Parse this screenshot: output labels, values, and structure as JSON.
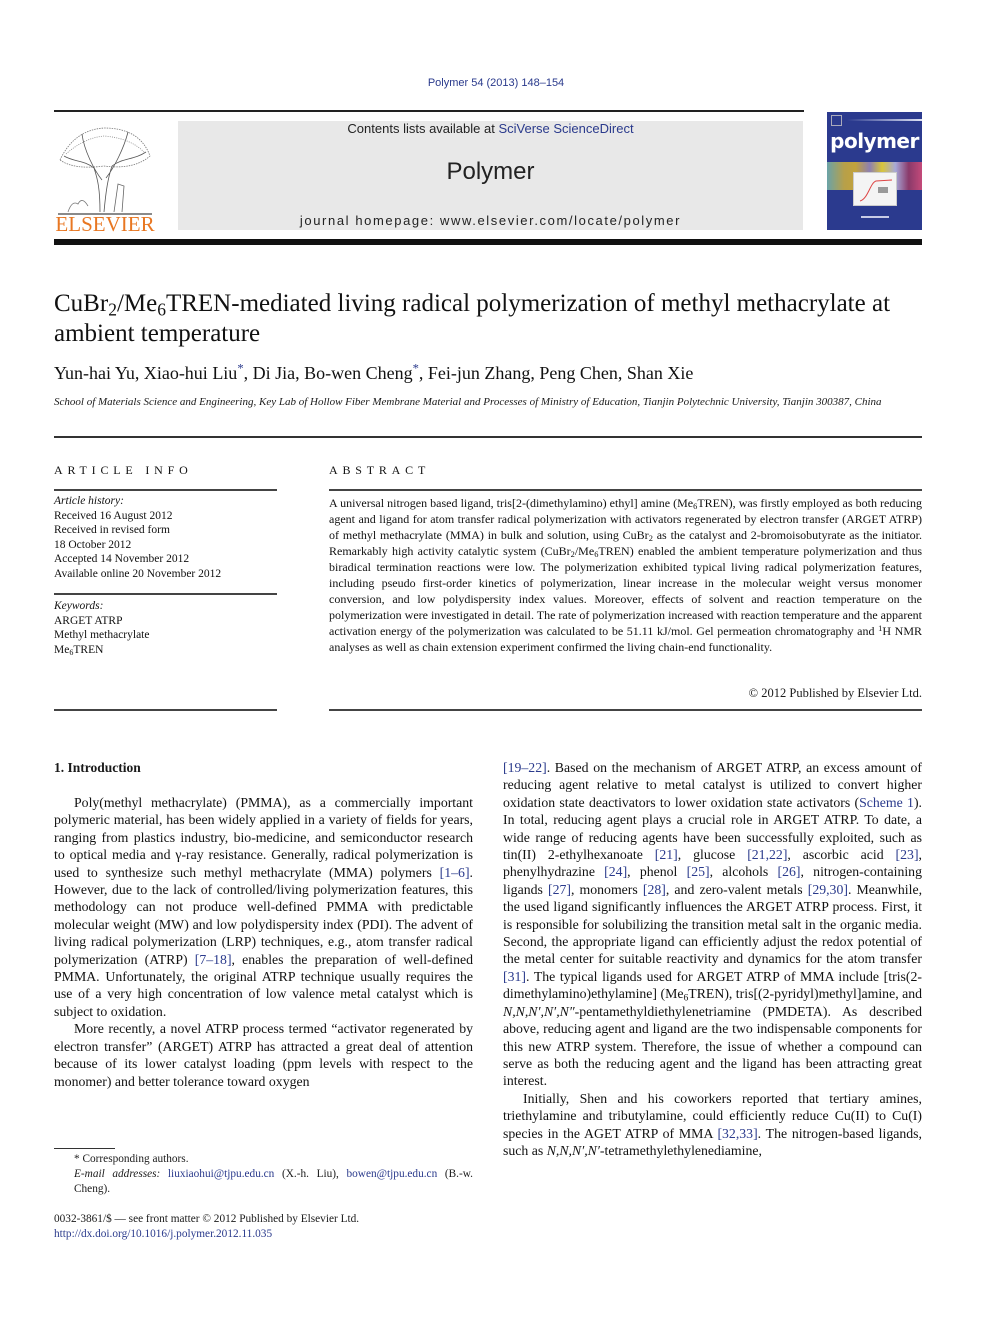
{
  "header": {
    "citation": "Polymer 54 (2013) 148–154",
    "contents_prefix": "Contents lists available at ",
    "contents_link": "SciVerse ScienceDirect",
    "journal_name": "Polymer",
    "homepage": "journal homepage: www.elsevier.com/locate/polymer",
    "publisher_logo_text": "ELSEVIER",
    "cover_title": "polymer",
    "colors": {
      "elsevier_orange": "#e87722",
      "link_blue": "#2a3a8c",
      "cover_blue": "#2b3a8e",
      "banner_gray": "#e8e8e8"
    }
  },
  "article": {
    "title_parts": [
      "CuBr",
      "2",
      "/Me",
      "6",
      "TREN-mediated living radical polymerization of methyl methacrylate at ambient temperature"
    ],
    "authors": [
      {
        "name": "Yun-hai Yu",
        "corresponding": false
      },
      {
        "name": "Xiao-hui Liu",
        "corresponding": true
      },
      {
        "name": "Di Jia",
        "corresponding": false
      },
      {
        "name": "Bo-wen Cheng",
        "corresponding": true
      },
      {
        "name": "Fei-jun Zhang",
        "corresponding": false
      },
      {
        "name": "Peng Chen",
        "corresponding": false
      },
      {
        "name": "Shan Xie",
        "corresponding": false
      }
    ],
    "affiliation": "School of Materials Science and Engineering, Key Lab of Hollow Fiber Membrane Material and Processes of Ministry of Education, Tianjin Polytechnic University, Tianjin 300387, China"
  },
  "article_info": {
    "heading": "ARTICLE INFO",
    "history_label": "Article history:",
    "history": [
      "Received 16 August 2012",
      "Received in revised form",
      "18 October 2012",
      "Accepted 14 November 2012",
      "Available online 20 November 2012"
    ],
    "keywords_label": "Keywords:",
    "keywords": [
      "ARGET ATRP",
      "Methyl methacrylate",
      "Me6TREN"
    ]
  },
  "abstract": {
    "heading": "ABSTRACT",
    "segments": [
      "A universal nitrogen based ligand, tris[2-(dimethylamino) ethyl] amine (Me",
      "6",
      "TREN), was firstly employed as both reducing agent and ligand for atom transfer radical polymerization with activators regenerated by electron transfer (ARGET ATRP) of methyl methacrylate (MMA) in bulk and solution, using CuBr",
      "2",
      " as the catalyst and 2-bromoisobutyrate as the initiator. Remarkably high activity catalytic system (CuBr",
      "2",
      "/Me",
      "6",
      "TREN) enabled the ambient temperature polymerization and thus biradical termination reactions were low. The polymerization exhibited typical living radical polymerization features, including pseudo first-order kinetics of polymerization, linear increase in the molecular weight versus monomer conversion, and low polydispersity index values. Moreover, effects of solvent and reaction temperature on the polymerization were investigated in detail. The rate of polymerization increased with reaction temperature and the apparent activation energy of the polymerization was calculated to be 51.11 kJ/mol. Gel permeation chromatography and ",
      "1",
      "H NMR analyses as well as chain extension experiment confirmed the living chain-end functionality."
    ],
    "copyright": "© 2012 Published by Elsevier Ltd."
  },
  "introduction": {
    "heading": "1.  Introduction",
    "p1": [
      "Poly(methyl methacrylate) (PMMA), as a commercially important polymeric material, has been widely applied in a variety of fields for years, ranging from plastics industry, bio-medicine, and semiconductor research to optical media and γ-ray resistance. Generally, radical polymerization is used to synthesize such methyl methacrylate (MMA) polymers ",
      "[1–6]",
      ". However, due to the lack of controlled/living polymerization features, this methodology can not produce well-defined PMMA with predictable molecular weight (MW) and low polydispersity index (PDI). The advent of living radical polymerization (LRP) techniques, e.g., atom transfer radical polymerization (ATRP) ",
      "[7–18]",
      ", enables the preparation of well-defined PMMA. Unfortunately, the original ATRP technique usually requires the use of a very high concentration of low valence metal catalyst which is subject to oxidation."
    ],
    "p2": "More recently, a novel ATRP process termed “activator regenerated by electron transfer” (ARGET) ATRP has attracted a great deal of attention because of its lower catalyst loading (ppm levels with respect to the monomer) and better tolerance toward oxygen",
    "p2_cont": [
      "[19–22]",
      ". Based on the mechanism of ARGET ATRP, an excess amount of reducing agent relative to metal catalyst is utilized to convert higher oxidation state deactivators to lower oxidation state activators (",
      "Scheme 1",
      "). In total, reducing agent plays a crucial role in ARGET ATRP. To date, a wide range of reducing agents have been successfully exploited, such as tin(II) 2-ethylhexanoate ",
      "[21]",
      ", glucose ",
      "[21,22]",
      ", ascorbic acid ",
      "[23]",
      ", phenylhydrazine ",
      "[24]",
      ", phenol ",
      "[25]",
      ", alcohols ",
      "[26]",
      ", nitrogen-containing ligands ",
      "[27]",
      ", monomers ",
      "[28]",
      ", and zero-valent metals ",
      "[29,30]",
      ". Meanwhile, the used ligand significantly influences the ARGET ATRP process. First, it is responsible for solubilizing the transition metal salt in the organic media. Second, the appropriate ligand can efficiently adjust the redox potential of the metal center for suitable reactivity and dynamics for the atom transfer ",
      "[31]",
      ". The typical ligands used for ARGET ATRP of MMA include [tris(2-dimethylamino)ethylamine] (Me",
      "6",
      "TREN), tris[(2-pyridyl)methyl]amine, and ",
      "N,N,N′,N′,N″",
      "-pentamethyldiethylenetriamine (PMDETA). As described above, reducing agent and ligand are the two indispensable components for this new ATRP system. Therefore, the issue of whether a compound can serve as both the reducing agent and the ligand has been attracting great interest."
    ],
    "p3": [
      "Initially, Shen and his coworkers reported that tertiary amines, triethylamine and tributylamine, could efficiently reduce Cu(II) to Cu(I) species in the AGET ATRP of MMA ",
      "[32,33]",
      ". The nitrogen-based ligands, such as ",
      "N,N,N′,N′",
      "-tetramethylethylenediamine,"
    ]
  },
  "footnotes": {
    "corresponding": "* Corresponding authors.",
    "email_label": "E-mail addresses:",
    "email1": "liuxiaohui@tjpu.edu.cn",
    "email1_name": " (X.-h. Liu), ",
    "email2": "bowen@tjpu.edu.cn",
    "email2_name": " (B.-w. Cheng).",
    "front_matter": "0032-3861/$ — see front matter © 2012 Published by Elsevier Ltd.",
    "doi": "http://dx.doi.org/10.1016/j.polymer.2012.11.035"
  }
}
